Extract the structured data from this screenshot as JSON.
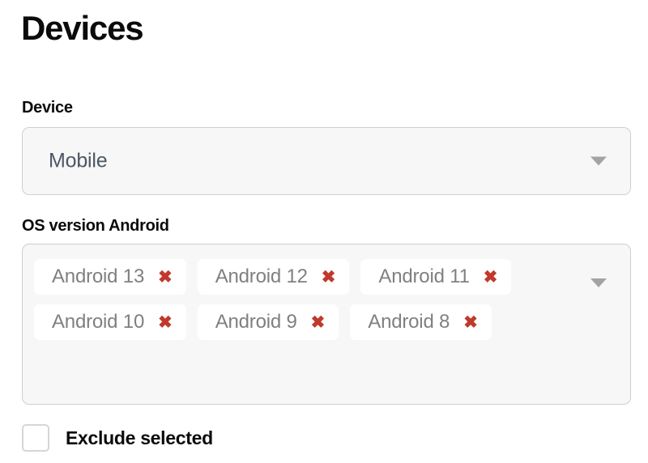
{
  "page": {
    "title": "Devices"
  },
  "device_field": {
    "label": "Device",
    "selected_value": "Mobile",
    "caret_icon": "chevron-down-icon"
  },
  "os_version_field": {
    "label": "OS version Android",
    "caret_icon": "chevron-down-icon",
    "remove_icon": "close-icon",
    "remove_glyph": "✖",
    "tags": [
      {
        "label": "Android 13"
      },
      {
        "label": "Android 12"
      },
      {
        "label": "Android 11"
      },
      {
        "label": "Android 10"
      },
      {
        "label": "Android 9"
      },
      {
        "label": "Android 8"
      }
    ]
  },
  "exclude_checkbox": {
    "label": "Exclude selected",
    "checked": false
  },
  "colors": {
    "text_primary": "#0b0b0b",
    "tag_text": "#808080",
    "select_value_text": "#4b5765",
    "remove_red": "#c0392b",
    "field_background": "#f7f7f7",
    "field_border": "#cfcfcf",
    "tag_background": "#ffffff",
    "caret_gray": "#a3a3a3",
    "page_background": "#ffffff"
  }
}
